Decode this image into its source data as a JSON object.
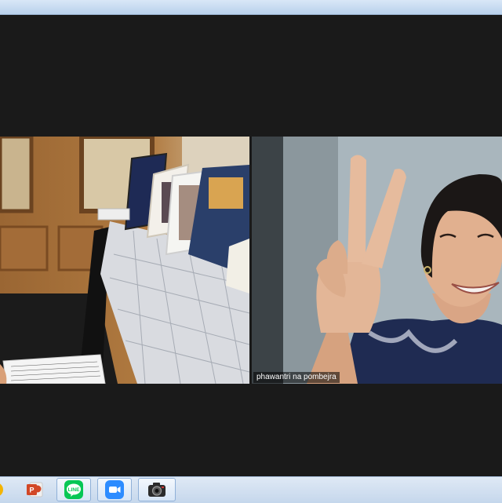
{
  "meeting": {
    "participants": [
      {
        "name": ""
      },
      {
        "name": "phawantri na pombejra"
      }
    ]
  },
  "taskbar": {
    "apps": [
      {
        "icon": "chrome-icon"
      },
      {
        "icon": "powerpoint-icon"
      },
      {
        "icon": "line-icon",
        "label": "LINE"
      },
      {
        "icon": "zoom-icon"
      },
      {
        "icon": "camera-app-icon"
      }
    ]
  },
  "colors": {
    "stage_background": "#1a1a1a",
    "line_green": "#06c755",
    "zoom_blue": "#2d8cff",
    "powerpoint_orange": "#d24726"
  }
}
